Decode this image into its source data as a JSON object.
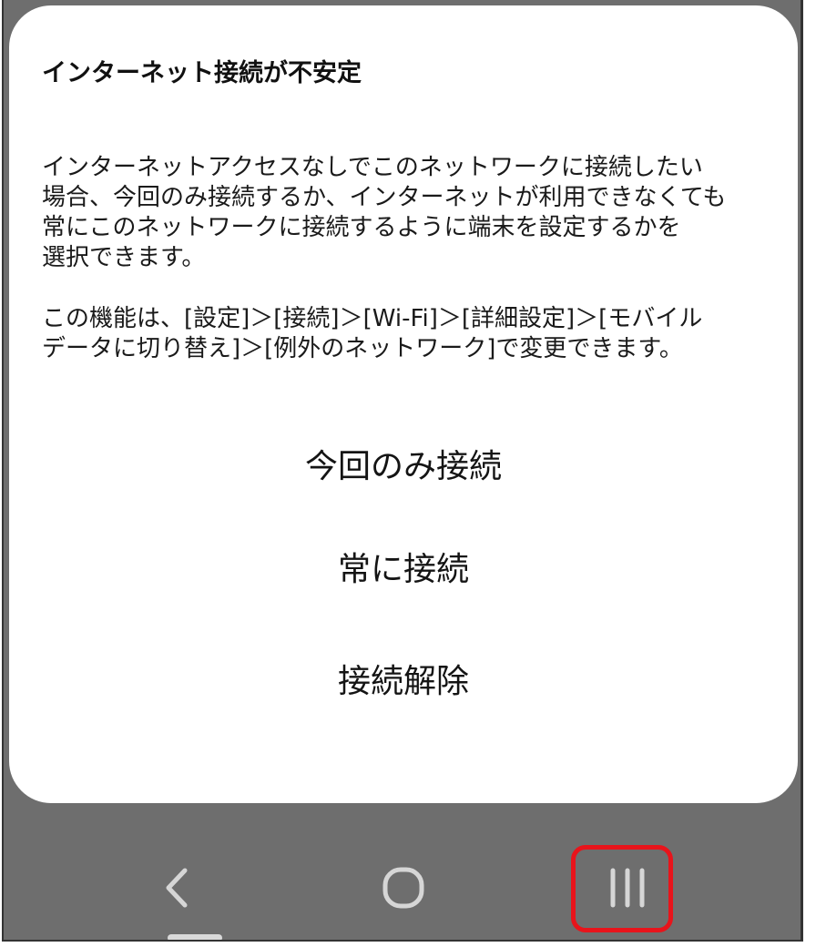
{
  "dialog": {
    "title": "インターネット接続が不安定",
    "body_lines_1": [
      "インターネットアクセスなしでこのネットワークに接続したい",
      "場合、今回のみ接続するか、インターネットが利用できなくても",
      "常にこのネットワークに接続するように端末を設定するかを",
      "選択できます。"
    ],
    "body_lines_2": [
      "この機能は、[設定]＞[接続]＞[Wi-Fi]＞[詳細設定]＞[モバイル",
      "データに切り替え]＞[例外のネットワーク]で変更できます。"
    ],
    "buttons": {
      "connect_once": "今回のみ接続",
      "always_connect": "常に接続",
      "disconnect": "接続解除"
    }
  },
  "navbar": {
    "back_icon": "back-chevron-icon",
    "home_icon": "home-circle-icon",
    "recent_icon": "recent-apps-icon"
  },
  "colors": {
    "dialog_background": "#ffffff",
    "screen_background": "#6e6e6e",
    "highlight": "#e8141b",
    "nav_icon": "#d6d6d6"
  }
}
